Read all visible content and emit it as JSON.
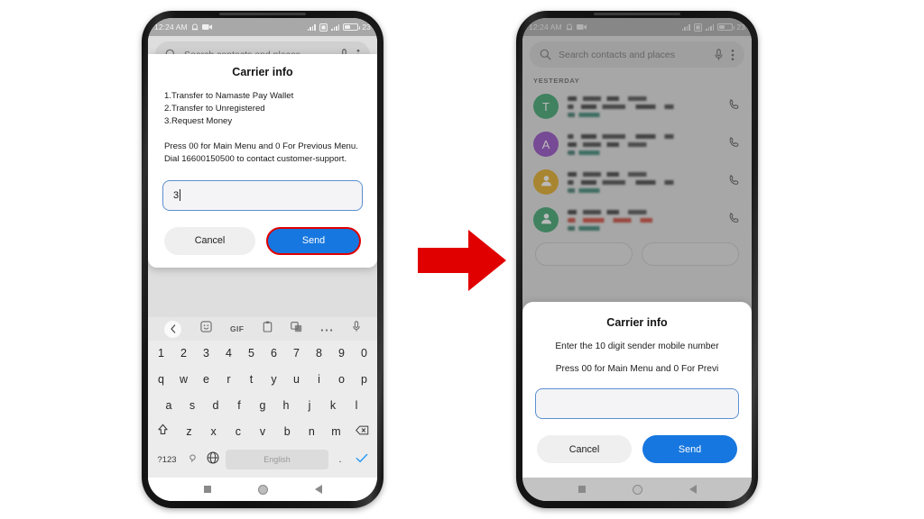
{
  "left_phone": {
    "statusbar": {
      "time": "12:24 AM",
      "battery_percent": "23",
      "icons": [
        "alarm-icon",
        "video-camera-icon",
        "signal-bars-icon",
        "sd-card-icon",
        "signal-bars-2-icon",
        "battery-icon"
      ]
    },
    "search": {
      "placeholder": "Search contacts and places",
      "icons": [
        "search-icon",
        "microphone-icon",
        "overflow-menu-icon"
      ]
    },
    "dialog": {
      "title": "Carrier info",
      "menu_lines": [
        "1.Transfer to Namaste Pay Wallet",
        "2.Transfer to Unregistered",
        "3.Request Money"
      ],
      "paragraph": "Press  00 for Main Menu and 0 For Previous Menu. Dial 16600150500 to contact customer-support.",
      "input_value": "3",
      "cancel_label": "Cancel",
      "send_label": "Send",
      "send_highlight_color": "#e00000",
      "send_color": "#1777e0"
    },
    "keyboard": {
      "toolbar": [
        "back-chevron-icon",
        "sticker-icon",
        "GIF",
        "clipboard-icon",
        "translate-icon",
        "more-dots-icon",
        "microphone-icon"
      ],
      "row_numbers": [
        "1",
        "2",
        "3",
        "4",
        "5",
        "6",
        "7",
        "8",
        "9",
        "0"
      ],
      "row_q": [
        "q",
        "w",
        "e",
        "r",
        "t",
        "y",
        "u",
        "i",
        "o",
        "p"
      ],
      "row_a": [
        "a",
        "s",
        "d",
        "f",
        "g",
        "h",
        "j",
        "k",
        "l"
      ],
      "row_z": [
        "z",
        "x",
        "c",
        "v",
        "b",
        "n",
        "m"
      ],
      "symbols_key": "?123",
      "space_label": "English",
      "period_key": ".",
      "comma_key": ","
    },
    "navbar": [
      "recents-square-icon",
      "home-circle-icon",
      "back-triangle-icon"
    ]
  },
  "right_phone": {
    "statusbar": {
      "time": "12:24 AM",
      "battery_percent": "23"
    },
    "search": {
      "placeholder": "Search contacts and places"
    },
    "section_label": "YESTERDAY",
    "contacts": [
      {
        "avatar_letter": "T",
        "avatar_color": "#2e9e63",
        "avatar_type": "letter"
      },
      {
        "avatar_letter": "A",
        "avatar_color": "#8a3fc0",
        "avatar_type": "letter"
      },
      {
        "avatar_letter": "",
        "avatar_color": "#e0a412",
        "avatar_type": "person"
      },
      {
        "avatar_letter": "",
        "avatar_color": "#2e9e63",
        "avatar_type": "person"
      }
    ],
    "dialog": {
      "title": "Carrier info",
      "line1": "Enter the 10 digit sender mobile number",
      "line2": "Press  00 for Main Menu and 0 For Previ",
      "input_value": "",
      "cancel_label": "Cancel",
      "send_label": "Send",
      "send_color": "#1777e0"
    },
    "navbar": [
      "recents-square-icon",
      "home-circle-icon",
      "back-triangle-icon"
    ]
  },
  "arrow": {
    "color": "#e00000",
    "direction": "right"
  }
}
